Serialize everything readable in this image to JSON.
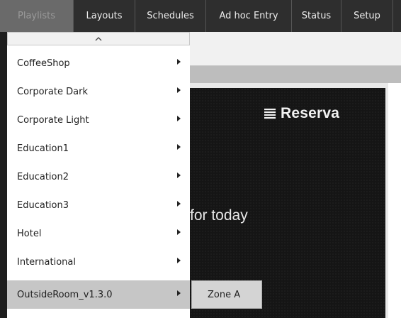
{
  "nav": {
    "tabs": [
      {
        "label": "Playlists"
      },
      {
        "label": "Layouts"
      },
      {
        "label": "Schedules"
      },
      {
        "label": "Ad hoc Entry"
      },
      {
        "label": "Status"
      },
      {
        "label": "Setup"
      }
    ]
  },
  "preview": {
    "brand_name": "Reserva",
    "text": "for today"
  },
  "menu": {
    "items": [
      {
        "label": "CoffeeShop"
      },
      {
        "label": "Corporate Dark"
      },
      {
        "label": "Corporate Light"
      },
      {
        "label": "Education1"
      },
      {
        "label": "Education2"
      },
      {
        "label": "Education3"
      },
      {
        "label": "Hotel"
      },
      {
        "label": "International"
      },
      {
        "label": "OutsideRoom_v1.3.0"
      }
    ],
    "submenu": {
      "label": "Zone A"
    }
  }
}
